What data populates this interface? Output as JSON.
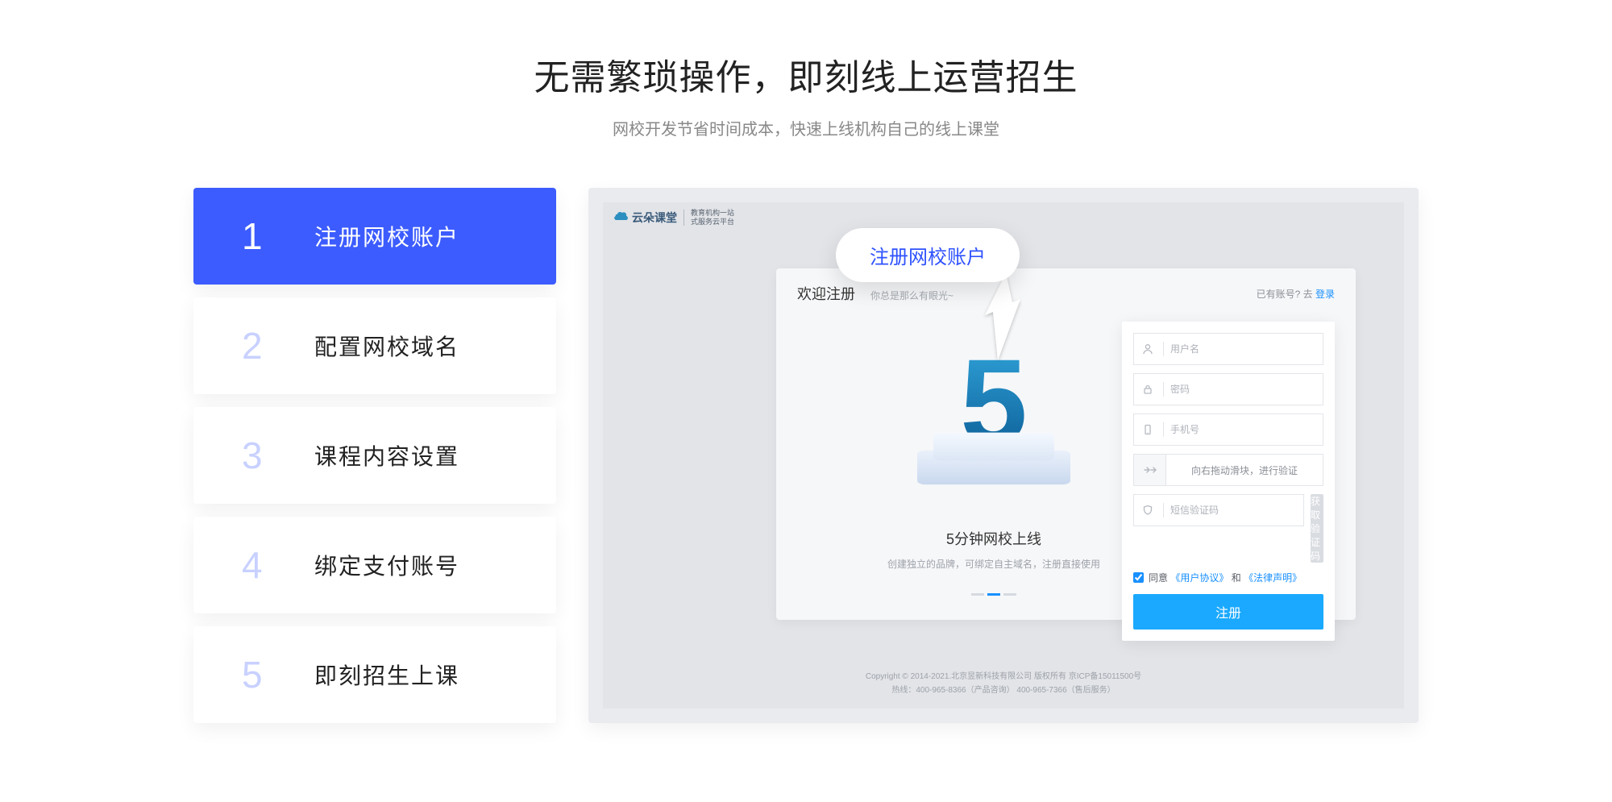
{
  "header": {
    "title": "无需繁琐操作，即刻线上运营招生",
    "subtitle": "网校开发节省时间成本，快速上线机构自己的线上课堂"
  },
  "steps": [
    {
      "num": "1",
      "label": "注册网校账户",
      "active": true
    },
    {
      "num": "2",
      "label": "配置网校域名",
      "active": false
    },
    {
      "num": "3",
      "label": "课程内容设置",
      "active": false
    },
    {
      "num": "4",
      "label": "绑定支付账号",
      "active": false
    },
    {
      "num": "5",
      "label": "即刻招生上课",
      "active": false
    }
  ],
  "callout": {
    "text": "注册网校账户"
  },
  "mock": {
    "logo_text": "云朵课堂",
    "logo_sub_line1": "教育机构一站",
    "logo_sub_line2": "式服务云平台",
    "welcome_title": "欢迎注册",
    "welcome_sub": "你总是那么有眼光~",
    "login_hint_prefix": "已有账号? 去",
    "login_link": "登录",
    "illus_title": "5分钟网校上线",
    "illus_desc": "创建独立的品牌，可绑定自主域名，注册直接使用",
    "form": {
      "username_ph": "用户名",
      "password_ph": "密码",
      "phone_ph": "手机号",
      "slider_text": "向右拖动滑块，进行验证",
      "code_ph": "短信验证码",
      "code_btn": "获取验证码",
      "agree_prefix": "同意",
      "agree_link1": "《用户协议》",
      "agree_and": "和",
      "agree_link2": "《法律声明》",
      "submit": "注册"
    },
    "footer_line1": "Copyright © 2014-2021.北京昱新科技有限公司 版权所有  京ICP备15011500号",
    "footer_line2": "热线：400-965-8366（产品咨询） 400-965-7366（售后服务）"
  }
}
